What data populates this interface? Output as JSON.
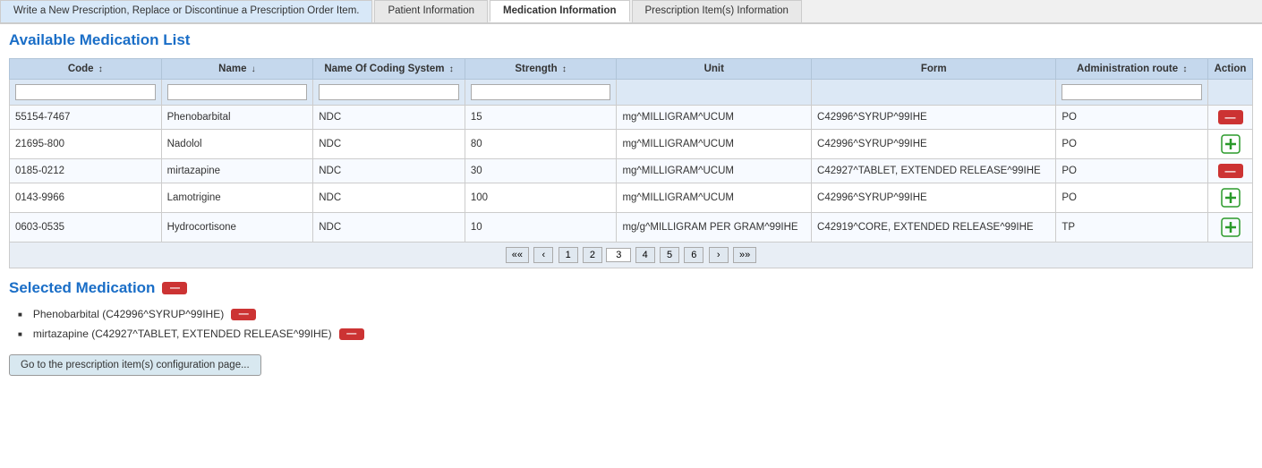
{
  "tabs": [
    {
      "id": "tab-write",
      "label": "Write a New Prescription, Replace or Discontinue a Prescription Order Item.",
      "active": false
    },
    {
      "id": "tab-patient",
      "label": "Patient Information",
      "active": false
    },
    {
      "id": "tab-medication",
      "label": "Medication Information",
      "active": true
    },
    {
      "id": "tab-prescription",
      "label": "Prescription Item(s) Information",
      "active": false
    }
  ],
  "available_list": {
    "title": "Available Medication List",
    "columns": [
      {
        "id": "code",
        "label": "Code",
        "sort": "↕"
      },
      {
        "id": "name",
        "label": "Name",
        "sort": "↓"
      },
      {
        "id": "coding_system",
        "label": "Name Of Coding System",
        "sort": "↕"
      },
      {
        "id": "strength",
        "label": "Strength",
        "sort": "↕"
      },
      {
        "id": "unit",
        "label": "Unit",
        "sort": ""
      },
      {
        "id": "form",
        "label": "Form",
        "sort": ""
      },
      {
        "id": "admin_route",
        "label": "Administration route",
        "sort": "↕"
      },
      {
        "id": "action",
        "label": "Action",
        "sort": ""
      }
    ],
    "rows": [
      {
        "code": "55154-7467",
        "name": "Phenobarbital",
        "coding_system": "NDC",
        "strength": "15",
        "unit": "mg^MILLIGRAM^UCUM",
        "form": "C42996^SYRUP^99IHE",
        "admin_route": "PO",
        "action": "remove"
      },
      {
        "code": "21695-800",
        "name": "Nadolol",
        "coding_system": "NDC",
        "strength": "80",
        "unit": "mg^MILLIGRAM^UCUM",
        "form": "C42996^SYRUP^99IHE",
        "admin_route": "PO",
        "action": "add"
      },
      {
        "code": "0185-0212",
        "name": "mirtazapine",
        "coding_system": "NDC",
        "strength": "30",
        "unit": "mg^MILLIGRAM^UCUM",
        "form": "C42927^TABLET, EXTENDED RELEASE^99IHE",
        "admin_route": "PO",
        "action": "remove"
      },
      {
        "code": "0143-9966",
        "name": "Lamotrigine",
        "coding_system": "NDC",
        "strength": "100",
        "unit": "mg^MILLIGRAM^UCUM",
        "form": "C42996^SYRUP^99IHE",
        "admin_route": "PO",
        "action": "add"
      },
      {
        "code": "0603-0535",
        "name": "Hydrocortisone",
        "coding_system": "NDC",
        "strength": "10",
        "unit": "mg/g^MILLIGRAM PER GRAM^99IHE",
        "form": "C42919^CORE, EXTENDED RELEASE^99IHE",
        "admin_route": "TP",
        "action": "add"
      }
    ],
    "pagination": {
      "first": "««",
      "prev": "‹",
      "pages": [
        "1",
        "2",
        "3",
        "4",
        "5",
        "6"
      ],
      "current_page": "3",
      "next": "›",
      "last": "»»"
    }
  },
  "selected": {
    "title": "Selected Medication",
    "items": [
      {
        "label": "Phenobarbital (C42996^SYRUP^99IHE)"
      },
      {
        "label": "mirtazapine (C42927^TABLET, EXTENDED RELEASE^99IHE)"
      }
    ],
    "go_button_label": "Go to the prescription item(s) configuration page..."
  }
}
